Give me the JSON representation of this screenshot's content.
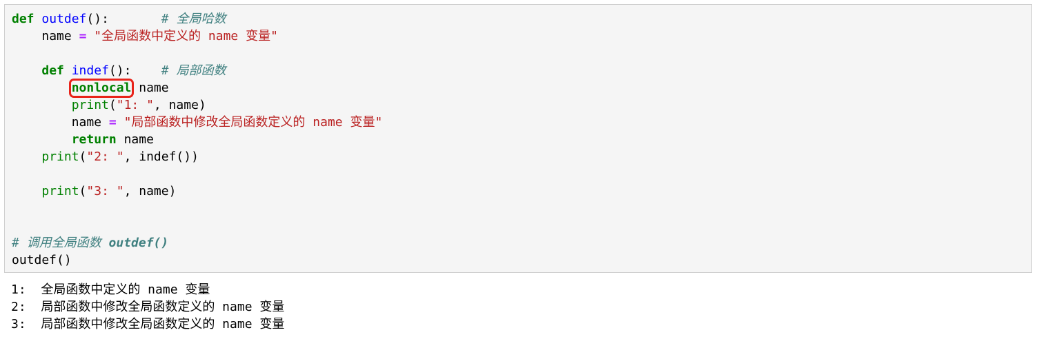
{
  "code": {
    "l1": {
      "kw": "def",
      "fn": "outdef",
      "punct": "():",
      "comment": "# 全局哈数"
    },
    "l2": {
      "var": "name",
      "op": "=",
      "str": "\"全局函数中定义的 name 变量\""
    },
    "l4": {
      "kw": "def",
      "fn": "indef",
      "punct": "():",
      "comment": "# 局部函数"
    },
    "l5": {
      "kw": "nonlocal",
      "rest": "name"
    },
    "l6": {
      "bi": "print",
      "open": "(",
      "str": "\"1: \"",
      "rest": ", name)"
    },
    "l7": {
      "var": "name",
      "op": "=",
      "str": "\"局部函数中修改全局函数定义的 name 变量\""
    },
    "l8": {
      "kw": "return",
      "rest": "name"
    },
    "l9": {
      "bi": "print",
      "open": "(",
      "str": "\"2: \"",
      "rest": ", indef())"
    },
    "l11": {
      "bi": "print",
      "open": "(",
      "str": "\"3: \"",
      "rest": ", name)"
    },
    "l14": {
      "comment": "# 调用全局函数",
      "comment_bold": "outdef()"
    },
    "l15": {
      "text": "outdef()"
    }
  },
  "output": [
    "1:  全局函数中定义的 name 变量",
    "2:  局部函数中修改全局函数定义的 name 变量",
    "3:  局部函数中修改全局函数定义的 name 变量"
  ],
  "colors": {
    "keyword": "#008000",
    "function_name": "#0000ff",
    "string": "#ba2121",
    "operator": "#aa22ff",
    "comment": "#408080",
    "highlight_box": "#e8231a",
    "cell_background": "#f5f5f5"
  }
}
